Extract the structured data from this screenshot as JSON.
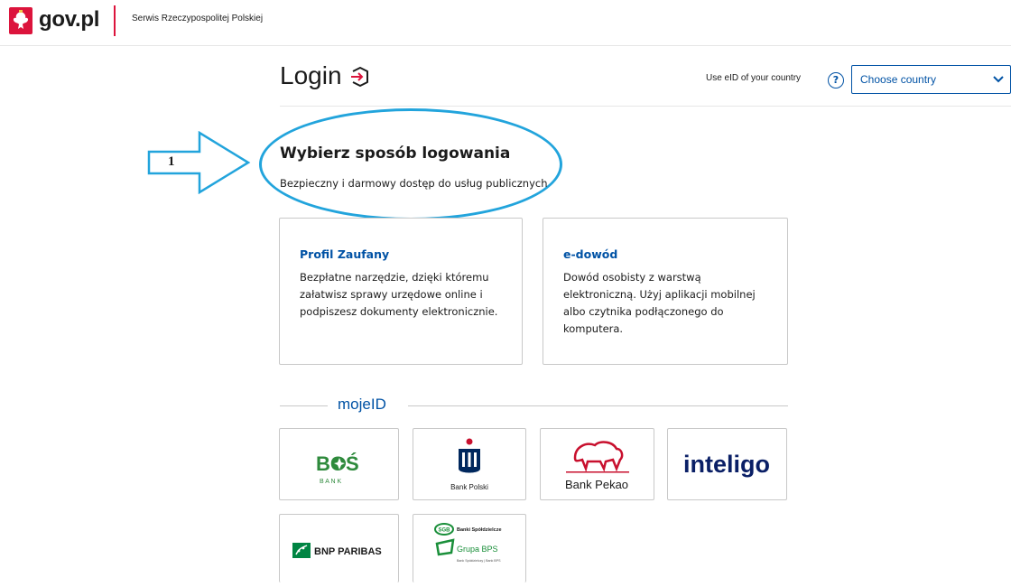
{
  "header": {
    "logo": "gov.pl",
    "tagline": "Serwis Rzeczypospolitej Polskiej"
  },
  "login": {
    "title": "Login",
    "eid_label": "Use eID of your country",
    "help_glyph": "?",
    "country_select_value": "Choose country"
  },
  "annotation": {
    "number": "1"
  },
  "main": {
    "heading": "Wybierz sposób logowania",
    "subheading": "Bezpieczny i darmowy dostęp do usług publicznych"
  },
  "cards": [
    {
      "title": "Profil Zaufany",
      "description": "Bezpłatne narzędzie, dzięki któremu załatwisz sprawy urzędowe online i podpiszesz dokumenty elektronicznie."
    },
    {
      "title": "e-dowód",
      "description": "Dowód osobisty z warstwą elektroniczną. Użyj aplikacji mobilnej albo czytnika podłączonego do komputera."
    }
  ],
  "mojeid": {
    "label": "mojeID"
  },
  "banks": {
    "bos": {
      "name": "BOŚ",
      "sub": "B A N K"
    },
    "pko": {
      "name": "Bank Polski"
    },
    "pekao": {
      "name": "Bank Pekao"
    },
    "inteligo": {
      "name": "inteligo"
    },
    "bnp": {
      "name": "BNP PARIBAS"
    },
    "bps": {
      "line1": "Banki Spółdzielcze",
      "line2": "Grupa BPS",
      "line3": "Bank Spółdzielczy | Bank BPS",
      "badge": "SGB"
    }
  },
  "colors": {
    "brand_blue": "#0052a5",
    "gov_red": "#dc143c",
    "annotation_blue": "#22a4dc",
    "bos_green": "#2e8a3c",
    "pko_navy": "#00275d",
    "pekao_red": "#c8102e",
    "inteligo_navy": "#0a1f66",
    "bnp_green": "#008543"
  }
}
